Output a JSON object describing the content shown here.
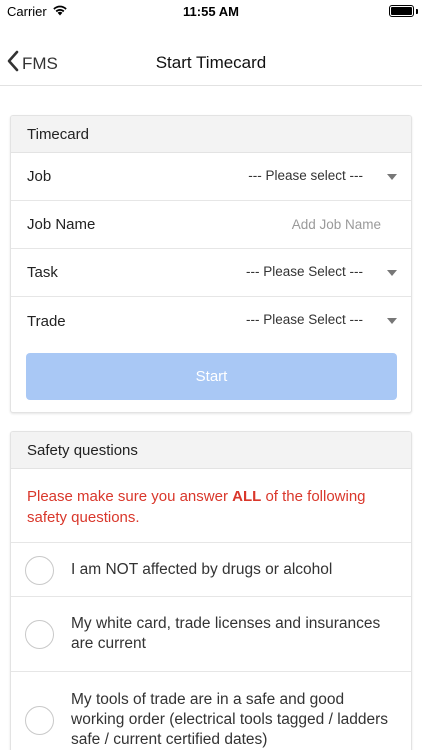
{
  "status_bar": {
    "carrier": "Carrier",
    "time": "11:55 AM",
    "wifi_icon": "wifi-icon",
    "battery_icon": "battery-full-icon"
  },
  "nav": {
    "back_label": "FMS",
    "back_icon": "chevron-left-icon",
    "title": "Start Timecard"
  },
  "timecard": {
    "header": "Timecard",
    "job": {
      "label": "Job",
      "value": "--- Please select ---"
    },
    "job_name": {
      "label": "Job Name",
      "placeholder": "Add Job Name",
      "value": ""
    },
    "task": {
      "label": "Task",
      "value": "--- Please Select ---"
    },
    "trade": {
      "label": "Trade",
      "value": "--- Please Select ---"
    },
    "start_label": "Start"
  },
  "safety": {
    "header": "Safety questions",
    "warning_before": "Please make sure you answer ",
    "warning_bold": "ALL",
    "warning_after": " of the following safety questions.",
    "questions": [
      {
        "text": "I am NOT affected by drugs or alcohol"
      },
      {
        "text": "My white card, trade licenses and insurances are current"
      },
      {
        "text": "My tools of trade are in a safe and good working order (electrical tools tagged / ladders safe / current certified dates)"
      }
    ]
  },
  "colors": {
    "start_button": "#a9c8f5",
    "warning_text": "#d9372b",
    "card_header_bg": "#f3f3f3"
  }
}
